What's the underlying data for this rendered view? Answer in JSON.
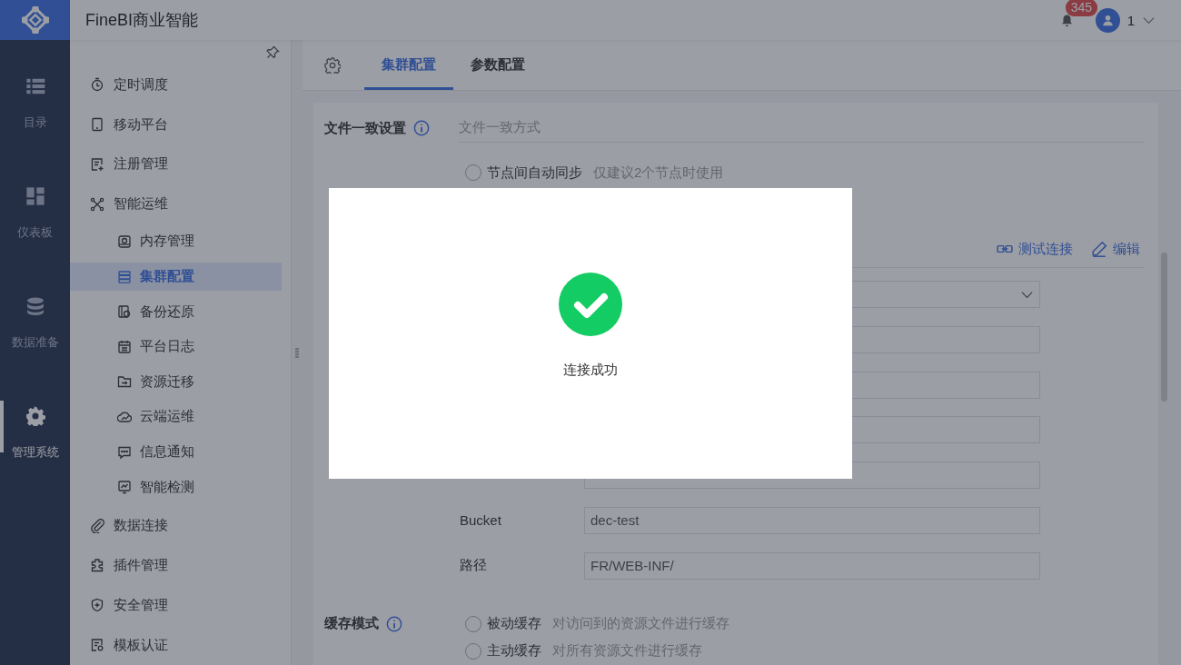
{
  "header": {
    "app_title": "FineBI商业智能",
    "notification_count": "345",
    "user_name": "1"
  },
  "nav": [
    {
      "label": "目录",
      "selected": false
    },
    {
      "label": "仪表板",
      "selected": false
    },
    {
      "label": "数据准备",
      "selected": false
    },
    {
      "label": "管理系统",
      "selected": true
    }
  ],
  "sidebar": {
    "items": [
      {
        "label": "定时调度",
        "selected": false
      },
      {
        "label": "移动平台",
        "selected": false
      },
      {
        "label": "注册管理",
        "selected": false
      },
      {
        "label": "智能运维",
        "selected": false,
        "children": [
          {
            "label": "内存管理",
            "selected": false
          },
          {
            "label": "集群配置",
            "selected": true
          },
          {
            "label": "备份还原",
            "selected": false
          },
          {
            "label": "平台日志",
            "selected": false
          },
          {
            "label": "资源迁移",
            "selected": false
          },
          {
            "label": "云端运维",
            "selected": false
          },
          {
            "label": "信息通知",
            "selected": false
          },
          {
            "label": "智能检测",
            "selected": false
          }
        ]
      },
      {
        "label": "数据连接",
        "selected": false
      },
      {
        "label": "插件管理",
        "selected": false
      },
      {
        "label": "安全管理",
        "selected": false
      },
      {
        "label": "模板认证",
        "selected": false
      }
    ]
  },
  "tabs": [
    {
      "label": "集群配置",
      "selected": true
    },
    {
      "label": "参数配置",
      "selected": false
    }
  ],
  "file_consistency": {
    "label": "文件一致设置",
    "mode_title": "文件一致方式",
    "options": [
      {
        "label": "节点间自动同步",
        "hint": "仅建议2个节点时使用",
        "selected": false
      }
    ]
  },
  "storage": {
    "actions": [
      {
        "label": "测试连接"
      },
      {
        "label": "编辑"
      }
    ],
    "fields": [
      {
        "kind": "select"
      },
      {
        "kind": "text"
      },
      {
        "kind": "text"
      },
      {
        "kind": "text"
      },
      {
        "kind": "text"
      },
      {
        "kind": "text",
        "label": "Bucket",
        "value": "dec-test"
      },
      {
        "kind": "text",
        "label": "路径",
        "value": "FR/WEB-INF/"
      }
    ]
  },
  "cache_mode": {
    "label": "缓存模式",
    "options": [
      {
        "label": "被动缓存",
        "hint": "对访问到的资源文件进行缓存",
        "selected": false
      },
      {
        "label": "主动缓存",
        "hint": "对所有资源文件进行缓存",
        "selected": false
      }
    ]
  },
  "dialog": {
    "success": true,
    "message": "连接成功"
  }
}
